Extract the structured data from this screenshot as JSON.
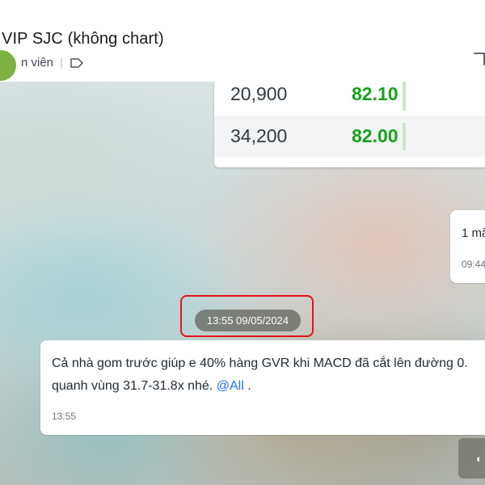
{
  "header": {
    "title": "VIP SJC (không chart)",
    "member_label": "n viên",
    "separator": "|",
    "avatar_color": "#7cb342"
  },
  "table": {
    "rows": [
      {
        "volume": "20,900",
        "price": "82.10"
      },
      {
        "volume": "34,200",
        "price": "82.00"
      }
    ],
    "price_color": "#1aa120"
  },
  "messages": [
    {
      "text": "1 mã",
      "time": "09:44"
    },
    {
      "line1": "Cả nhà gom trước giúp e 40% hàng GVR khi MACD đã cắt lên đường 0.",
      "line2_prefix": "quanh vùng 31.7-31.8x nhé.",
      "mention": "@All",
      "line2_suffix": ".",
      "time": "13:55"
    }
  ],
  "date_separator": "13:55 09/05/2024",
  "highlight_color": "#e0141c"
}
